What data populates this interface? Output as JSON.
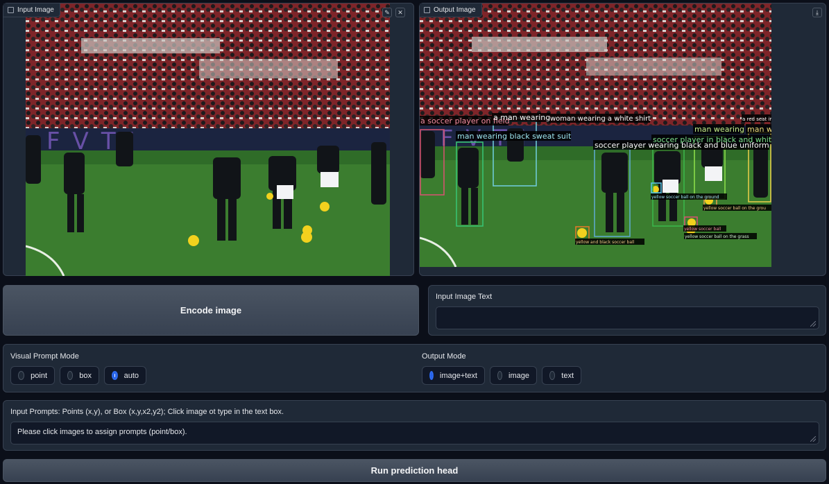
{
  "input_panel": {
    "label": "Input Image",
    "edit_icon": "pencil-icon",
    "close_icon": "close-icon"
  },
  "output_panel": {
    "label": "Output Image",
    "download_icon": "download-icon",
    "annotations": [
      "a soccer player on field",
      "a man wearing",
      "woman wearing a white shirt",
      "man wearing black sweat suit",
      "soccer player wearing black and blue uniform",
      "a red seat in",
      "man wearing",
      "man w",
      "soccer player in black and whit",
      "yellow soccer ball on the ground",
      "yellow soccer ball on the grou",
      "yellow soccer ball",
      "yellow soccer ball on the grass",
      "yellow and black soccer ball"
    ]
  },
  "encode_button": "Encode image",
  "input_image_text": {
    "label": "Input Image Text",
    "value": ""
  },
  "visual_prompt_mode": {
    "label": "Visual Prompt Mode",
    "options": [
      "point",
      "box",
      "auto"
    ],
    "selected": "auto"
  },
  "output_mode": {
    "label": "Output Mode",
    "options": [
      "image+text",
      "image",
      "text"
    ],
    "selected": "image+text"
  },
  "input_prompts": {
    "label": "Input Prompts: Points (x,y), or Box (x,y,x2,y2); Click image ot type in the text box.",
    "value": "Please click images to assign prompts (point/box)."
  },
  "run_button": "Run prediction head",
  "colors": {
    "background": "#0b0f19",
    "panel": "#1f2937",
    "accent": "#2563eb"
  }
}
